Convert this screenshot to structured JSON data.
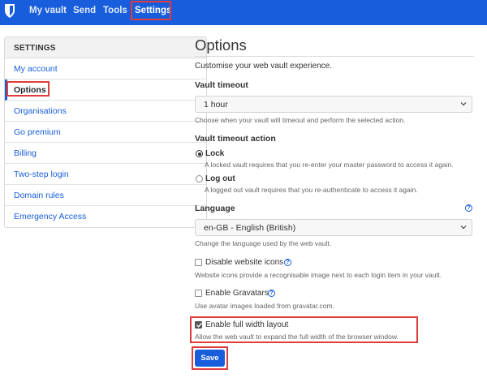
{
  "nav": {
    "items": [
      "My vault",
      "Send",
      "Tools",
      "Settings"
    ]
  },
  "sidebar": {
    "heading": "SETTINGS",
    "items": [
      "My account",
      "Options",
      "Organisations",
      "Go premium",
      "Billing",
      "Two-step login",
      "Domain rules",
      "Emergency Access"
    ]
  },
  "main": {
    "title": "Options",
    "subtitle": "Customise your web vault experience.",
    "vault_timeout": {
      "label": "Vault timeout",
      "value": "1 hour",
      "help": "Choose when your vault will timeout and perform the selected action."
    },
    "timeout_action": {
      "label": "Vault timeout action",
      "lock_label": "Lock",
      "lock_help": "A locked vault requires that you re-enter your master password to access it again.",
      "logout_label": "Log out",
      "logout_help": "A logged out vault requires that you re-authenticate to access it again."
    },
    "language": {
      "label": "Language",
      "value": "en-GB - English (British)",
      "help": "Change the language used by the web vault."
    },
    "website_icons": {
      "label": "Disable website icons",
      "help": "Website icons provide a recognisable image next to each login item in your vault."
    },
    "gravatars": {
      "label": "Enable Gravatars",
      "help": "Use avatar images loaded from gravatar.com."
    },
    "full_width": {
      "label": "Enable full width layout",
      "help": "Allow the web vault to expand the full width of the browser window."
    },
    "save_label": "Save"
  },
  "colors": {
    "brand": "#175ddc",
    "highlight": "#e03c3c"
  },
  "icons": {
    "logo": "shield-logo-icon",
    "caret": "chevron-down-icon",
    "help": "question-circle-icon"
  }
}
